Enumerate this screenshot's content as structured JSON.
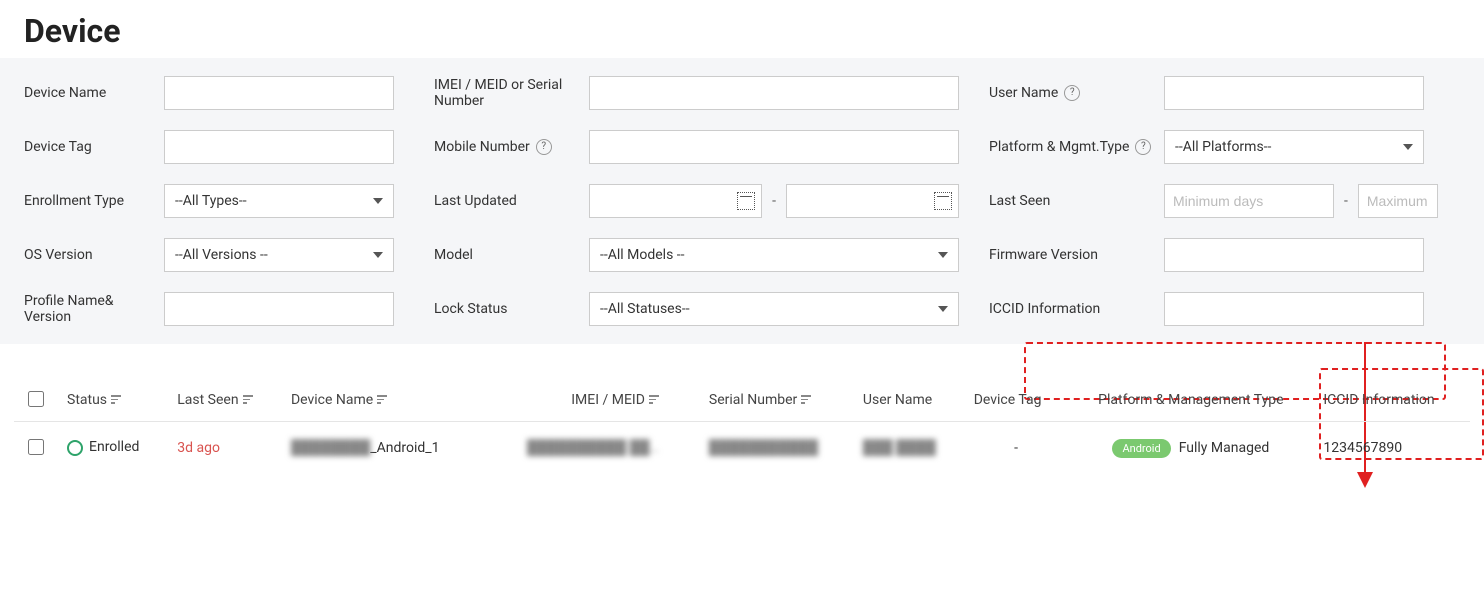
{
  "page": {
    "title": "Device"
  },
  "filters": {
    "device_name": {
      "label": "Device Name",
      "value": ""
    },
    "imei": {
      "label": "IMEI / MEID or Serial Number",
      "value": ""
    },
    "user_name": {
      "label": "User Name",
      "value": ""
    },
    "device_tag": {
      "label": "Device Tag",
      "value": ""
    },
    "mobile_number": {
      "label": "Mobile Number",
      "value": ""
    },
    "platform": {
      "label": "Platform & Mgmt.Type",
      "selected": "--All Platforms--"
    },
    "enroll_type": {
      "label": "Enrollment Type",
      "selected": "--All Types--"
    },
    "last_updated": {
      "label": "Last Updated",
      "from": "",
      "to": "",
      "dash": "-"
    },
    "last_seen": {
      "label": "Last Seen",
      "min_placeholder": "Minimum days",
      "max_placeholder": "Maximum",
      "dash": "-"
    },
    "os_version": {
      "label": "OS Version",
      "selected": "--All Versions --"
    },
    "model": {
      "label": "Model",
      "selected": "--All Models --"
    },
    "firmware": {
      "label": "Firmware Version",
      "value": ""
    },
    "profile": {
      "label": "Profile Name& Version",
      "value": ""
    },
    "lock_status": {
      "label": "Lock Status",
      "selected": "--All Statuses--"
    },
    "iccid": {
      "label": "ICCID Information",
      "value": ""
    }
  },
  "table": {
    "headers": {
      "status": "Status",
      "last_seen": "Last Seen",
      "device_name": "Device Name",
      "imei": "IMEI / MEID",
      "serial": "Serial Number",
      "user": "User Name",
      "tag": "Device Tag",
      "platform": "Platform & Management Type",
      "iccid": "ICCID Information"
    },
    "rows": [
      {
        "status": "Enrolled",
        "last_seen": "3d ago",
        "device_name_suffix": "_Android_1",
        "device_name_blur": "████████",
        "imei_blur": "██████████ ██…",
        "serial_blur": "███████████",
        "user_blur": "███ ████",
        "tag": "-",
        "platform_badge": "Android",
        "platform_text": "Fully Managed",
        "iccid": "1234567890"
      }
    ]
  }
}
